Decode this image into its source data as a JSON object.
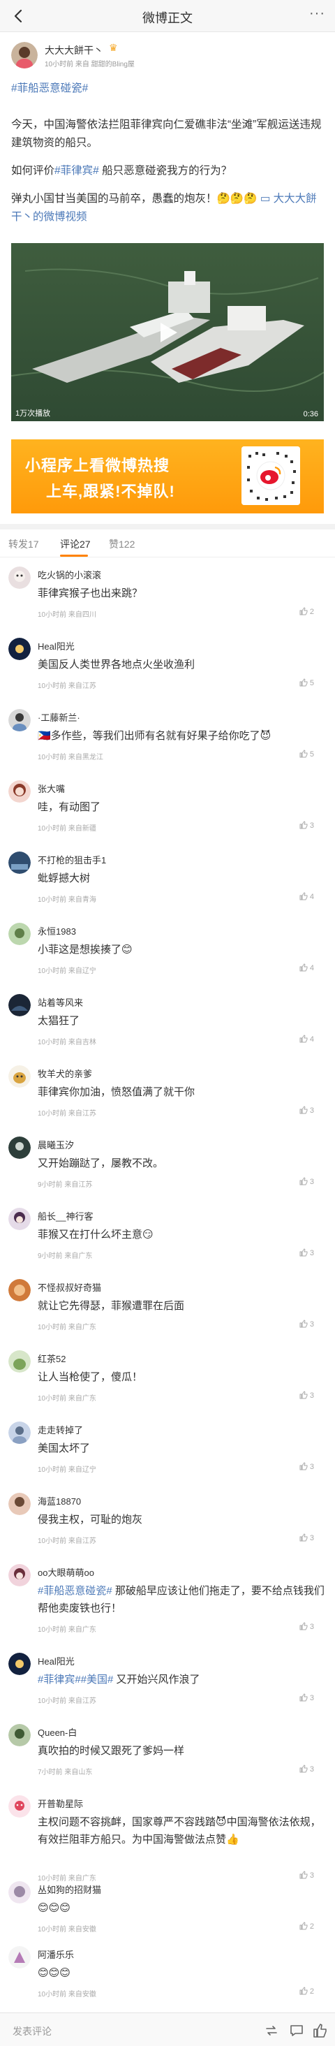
{
  "header": {
    "title": "微博正文",
    "back_icon": "back-arrow-icon",
    "more_label": "···"
  },
  "post": {
    "author": {
      "name": "大大大餅干丶",
      "badge_icon": "crown-icon",
      "meta": "10小时前 来自 甜甜的Bling屋"
    },
    "topic": "#菲船恶意碰瓷#",
    "paragraph1": "今天，中国海警依法拦阻菲律宾向仁爱礁非法“坐滩”军舰运送违规建筑物资的船只。",
    "para2_prefix": "如何评价",
    "para2_tag": "#菲律宾#",
    "para2_suffix": " 船只恶意碰瓷我方的行为？",
    "para3_text": "弹丸小国甘当美国的马前卒，愚蠢的炮灰！🤔🤔🤔 ",
    "para3_link": "大大大餅干丶的微博视频",
    "video": {
      "play_count": "1万次播放",
      "duration": "0:36"
    },
    "banner": {
      "line1": "小程序上看微博热搜",
      "line2": "上车,跟紧!不掉队!"
    }
  },
  "tabs": [
    {
      "label": "转发17"
    },
    {
      "label": "评论27"
    },
    {
      "label": "赞122"
    }
  ],
  "colors": {
    "accent": "#ff8200",
    "link": "#4c79b8",
    "banner": "#ffa514"
  },
  "comments": [
    {
      "name": "吃火锅的小滚滚",
      "text": "菲律宾猴子也出来跳？",
      "meta": "10小时前 来自四川",
      "likes": "2"
    },
    {
      "name": "Heal阳光",
      "text": "美国反人类世界各地点火坐收渔利",
      "meta": "10小时前 来自江苏",
      "likes": "5"
    },
    {
      "name": "·工藤新兰·",
      "text": "🇵🇭多作些，等我们出师有名就有好果子给你吃了😈",
      "meta": "10小时前 来自黑龙江",
      "likes": "5"
    },
    {
      "name": "张大嘴",
      "text": "哇，有动图了",
      "meta": "10小时前 来自新疆",
      "likes": "3"
    },
    {
      "name": "不打枪的狙击手1",
      "text": "蚍蜉撼大树",
      "meta": "10小时前 来自青海",
      "likes": "4"
    },
    {
      "name": "永恒1983",
      "text": "小菲这是想挨揍了😊",
      "meta": "10小时前 来自辽宁",
      "likes": "4"
    },
    {
      "name": "站着等风来",
      "text": "太猖狂了",
      "meta": "10小时前 来自吉林",
      "likes": "4"
    },
    {
      "name": "牧羊犬的亲爹",
      "text": "菲律宾你加油，愤怒值满了就干你",
      "meta": "10小时前 来自江苏",
      "likes": "3"
    },
    {
      "name": "晨曦玉汐",
      "text": "又开始蹦跶了，屡教不改。",
      "meta": "9小时前 来自江苏",
      "likes": "3"
    },
    {
      "name": "船长__神行客",
      "text": "菲猴又在打什么坏主意😏",
      "meta": "9小时前 来自广东",
      "likes": "3"
    },
    {
      "name": "不怪叔叔好奇猫",
      "text": "就让它先得瑟，菲猴遭罪在后面",
      "meta": "10小时前 来自广东",
      "likes": "3"
    },
    {
      "name": "红茶52",
      "text": "让人当枪使了，傻瓜！",
      "meta": "10小时前 来自广东",
      "likes": "3"
    },
    {
      "name": "走走转掉了",
      "text": "美国太坏了",
      "meta": "10小时前 来自辽宁",
      "likes": "3"
    },
    {
      "name": "海蓝18870",
      "text": "侵我主权，可耻的炮灰",
      "meta": "10小时前 来自江苏",
      "likes": "3"
    },
    {
      "name": "oo大眼萌萌oo",
      "text_tag": "#菲船恶意碰瓷#",
      "text": " 那破船早应该让他们拖走了，要不给点钱我们帮他卖废铁也行！",
      "meta": "10小时前 来自广东",
      "likes": "3"
    },
    {
      "name": "Heal阳光",
      "text_tag": "#菲律宾#",
      "text_tag2": "#美国#",
      "text": " 又开始兴风作浪了",
      "meta": "10小时前 来自江苏",
      "likes": "3"
    },
    {
      "name": "Queen-白",
      "text": "真吹拍的时候又跟死了爹妈一样",
      "meta": "7小时前 来自山东",
      "likes": "3"
    },
    {
      "name": "开普勒星际",
      "text": "主权问题不容挑衅，国家尊严不容践踏😈中国海警依法依规，有效拦阻菲方船只。为中国海警做法点赞👍",
      "meta": "10小时前 来自广东",
      "likes": "3"
    },
    {
      "name": "丛如狗的招财猫",
      "text": "😊😊😊",
      "meta": "10小时前 来自安徽",
      "likes": "2"
    },
    {
      "name": "阿潘乐乐",
      "text": "😊😊😊",
      "meta": "10小时前 来自安徽",
      "likes": "2"
    }
  ],
  "bottom": {
    "input_placeholder": "发表评论",
    "icons": [
      "repost-icon",
      "comment-icon",
      "like-icon"
    ]
  }
}
